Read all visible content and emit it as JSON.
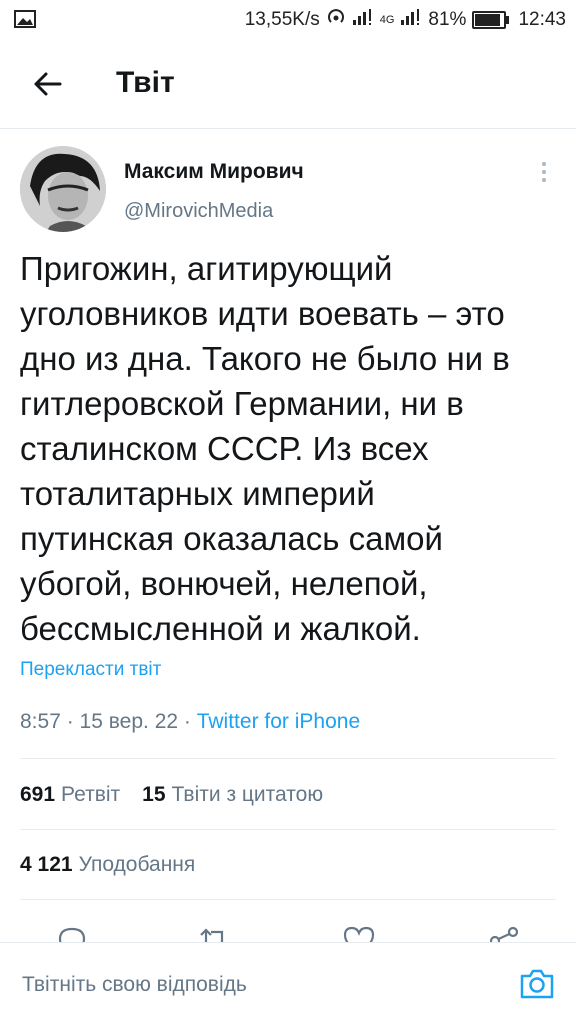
{
  "status_bar": {
    "network_speed": "13,55K/s",
    "network_type": "4G",
    "battery_text": "81%",
    "battery_level": 0.81,
    "time": "12:43",
    "icons": [
      "image-icon",
      "hotspot-icon",
      "signal-icon",
      "battery-icon"
    ]
  },
  "header": {
    "title": "Твіт",
    "back_icon": "arrow-left-icon"
  },
  "tweet": {
    "author_name": "Максим Мирович",
    "author_handle": "@MirovichMedia",
    "text": "Пригожин, агитирующий\nуголовников идти воевать – это\nдно из дна. Такого не было ни в\nгитлеровской Германии, ни в\nсталинском СССР. Из всех\nтоталитарных империй\nпутинская оказалась самой\nубогой, вонючей, нелепой,\nбессмысленной и жалкой.",
    "translate_label": "Перекласти твіт",
    "time": "8:57",
    "date": "15 вер. 22",
    "source": "Twitter for iPhone"
  },
  "stats": {
    "retweets_count": "691",
    "retweets_label": "Ретвіт",
    "quotes_count": "15",
    "quotes_label": "Твіти з цитатою",
    "likes_count": "4 121",
    "likes_label": "Уподобання"
  },
  "actions": [
    "reply-icon",
    "retweet-icon",
    "like-icon",
    "share-icon"
  ],
  "reply_bar": {
    "placeholder": "Твітніть свою відповідь",
    "camera_icon": "camera-icon"
  },
  "colors": {
    "accent": "#1da1f2",
    "secondary_text": "#657786",
    "primary_text": "#14171a"
  }
}
